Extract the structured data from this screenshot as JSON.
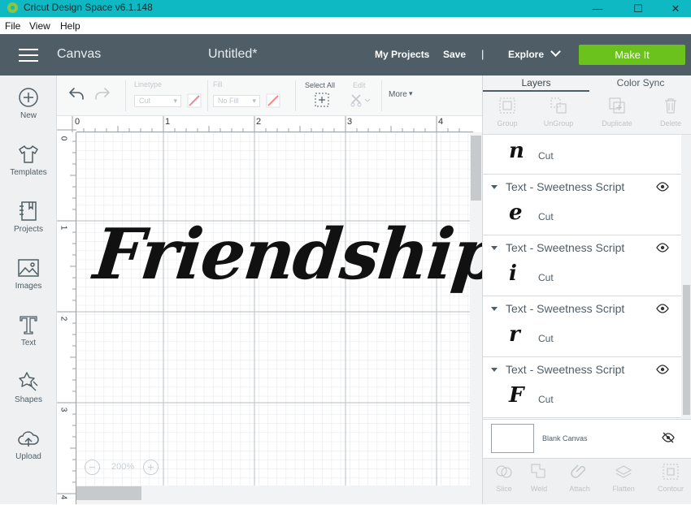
{
  "titlebar": {
    "title": "Cricut Design Space  v6.1.148"
  },
  "window": {
    "minimize": "—",
    "maximize": "☐",
    "close": "✕"
  },
  "menu": {
    "file": "File",
    "view": "View",
    "help": "Help"
  },
  "header": {
    "section": "Canvas",
    "doc_title": "Untitled*",
    "my_projects": "My Projects",
    "save": "Save",
    "separator": "|",
    "explore": "Explore",
    "make_it": "Make It"
  },
  "sidebar": {
    "items": [
      {
        "label": "New",
        "icon": "plus-circle-icon"
      },
      {
        "label": "Templates",
        "icon": "tshirt-icon"
      },
      {
        "label": "Projects",
        "icon": "notebook-icon"
      },
      {
        "label": "Images",
        "icon": "image-icon"
      },
      {
        "label": "Text",
        "icon": "text-t-icon"
      },
      {
        "label": "Shapes",
        "icon": "shapes-icon"
      },
      {
        "label": "Upload",
        "icon": "cloud-upload-icon"
      }
    ]
  },
  "toolbar": {
    "linetype_label": "Linetype",
    "linetype_value": "Cut",
    "fill_label": "Fill",
    "fill_value": "No Fill",
    "select_all": "Select All",
    "edit": "Edit",
    "more": "More"
  },
  "canvas": {
    "ruler_top": [
      "0",
      "1",
      "2",
      "3",
      "4"
    ],
    "ruler_left": [
      "0",
      "1",
      "2",
      "3",
      "4"
    ],
    "text": "Friendship",
    "zoom_minus": "−",
    "zoom_plus": "+",
    "zoom": "200%"
  },
  "panel": {
    "tabs": [
      "Layers",
      "Color Sync"
    ],
    "tools": [
      "Group",
      "UnGroup",
      "Duplicate",
      "Delete"
    ],
    "layers": [
      {
        "name": "",
        "glyph": "n",
        "operation": "Cut"
      },
      {
        "name": "Text - Sweetness Script",
        "glyph": "e",
        "operation": "Cut"
      },
      {
        "name": "Text - Sweetness Script",
        "glyph": "i",
        "operation": "Cut"
      },
      {
        "name": "Text - Sweetness Script",
        "glyph": "r",
        "operation": "Cut"
      },
      {
        "name": "Text - Sweetness Script",
        "glyph": "F",
        "operation": "Cut"
      }
    ],
    "blank_canvas": "Blank Canvas",
    "bottom_tools": [
      "Slice",
      "Weld",
      "Attach",
      "Flatten",
      "Contour"
    ]
  },
  "colors": {
    "accent": "#0fb9c3",
    "header": "#4f5d66",
    "make_it": "#6cc21c"
  }
}
